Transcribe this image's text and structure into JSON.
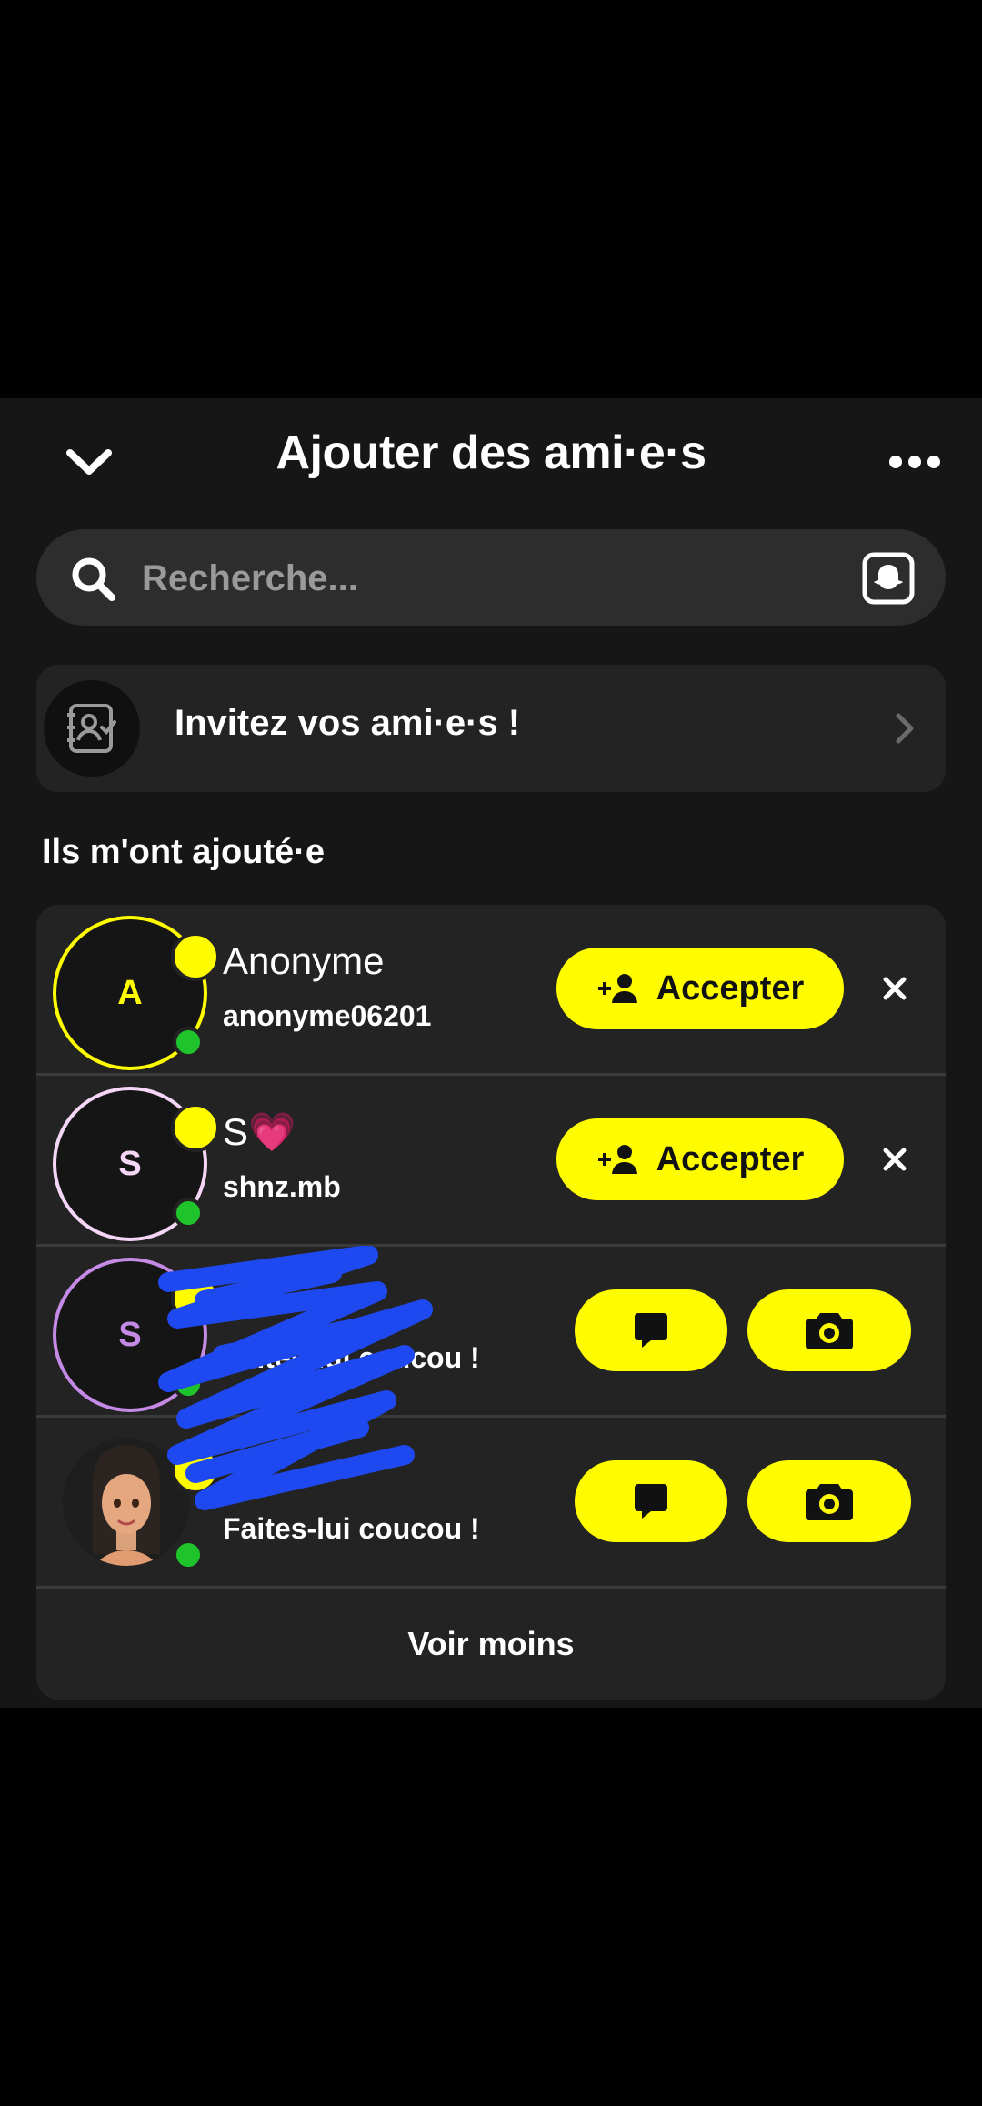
{
  "header": {
    "title": "Ajouter des ami·e·s"
  },
  "search": {
    "placeholder": "Recherche..."
  },
  "invite": {
    "label": "Invitez vos ami·e·s !"
  },
  "section": {
    "title": "Ils m'ont ajouté·e"
  },
  "requests": [
    {
      "initial": "A",
      "name": "Anonyme",
      "username": "anonyme06201",
      "accept_label": "Accepter",
      "ring_color": "#fffc00",
      "initial_color": "#fffc00"
    },
    {
      "initial": "S",
      "name": "S💗",
      "username": "shnz.mb",
      "accept_label": "Accepter",
      "ring_color": "#f6d6f6",
      "initial_color": "#f6d6f6"
    }
  ],
  "friends": [
    {
      "initial": "S",
      "subtitle": "Faites-lui coucou !",
      "ring_color": "#c58ae6",
      "initial_color": "#c58ae6"
    },
    {
      "subtitle": "Faites-lui coucou !",
      "avatar": "bitmoji-avatar"
    }
  ],
  "footer": {
    "see_less": "Voir moins"
  },
  "colors": {
    "accent": "#fffc00",
    "online": "#1fc32c",
    "background": "#161616",
    "card": "#232323"
  }
}
